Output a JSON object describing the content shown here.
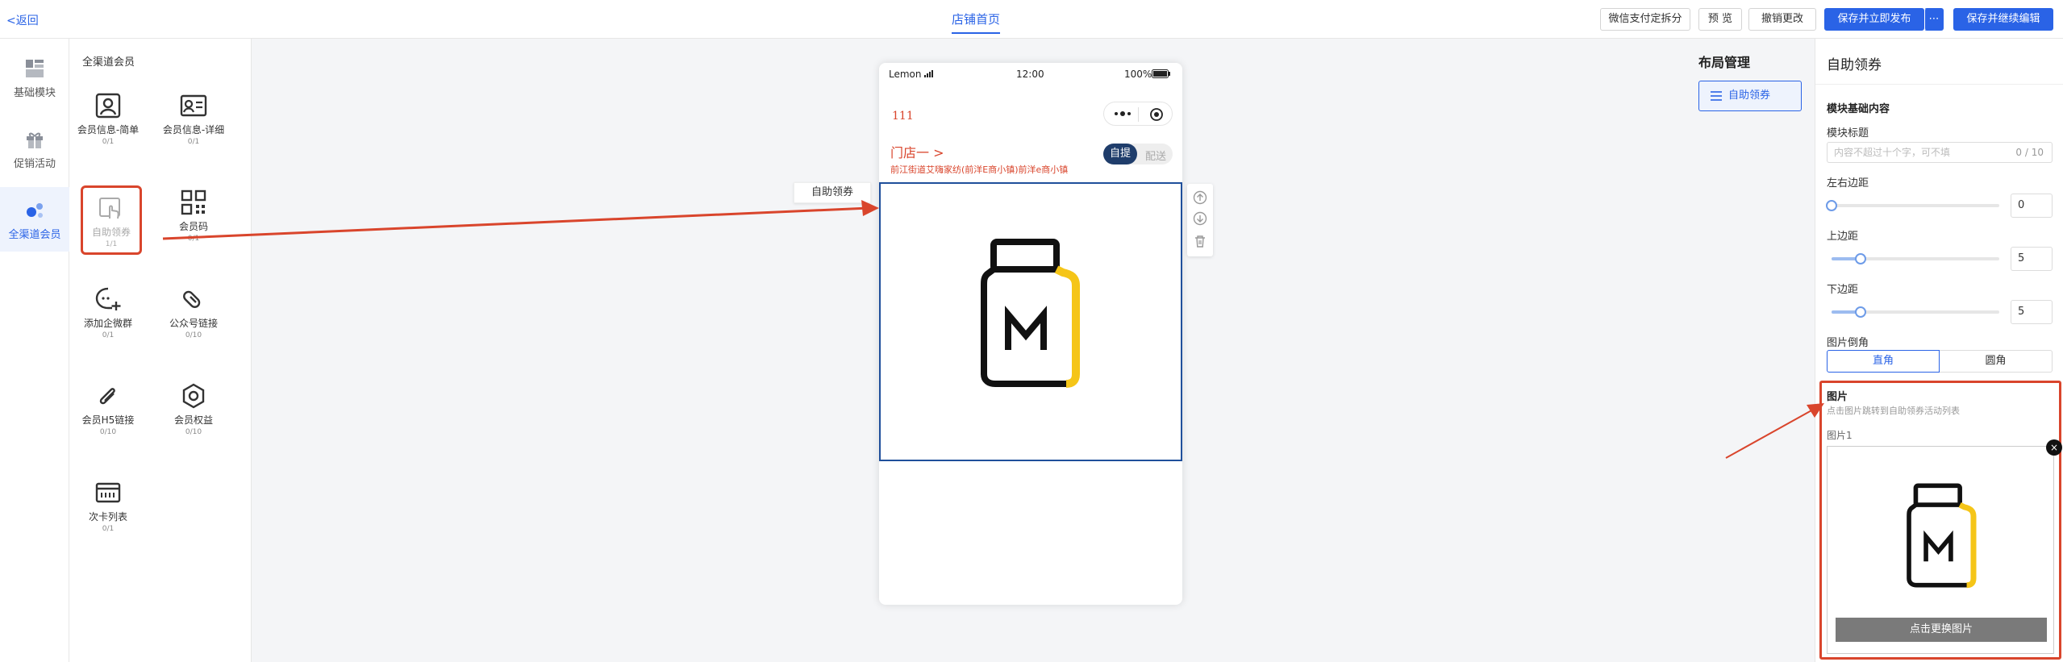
{
  "topbar": {
    "back": "<返回",
    "tab": "店铺首页",
    "buttons": [
      "微信支付定拆分",
      "预 览",
      "撤销更改",
      "保存并立即发布",
      "⋯",
      "保存并继续编辑"
    ]
  },
  "leftnav": {
    "items": [
      {
        "label": "基础模块",
        "icon": "layout-blocks-icon"
      },
      {
        "label": "促销活动",
        "icon": "gift-icon"
      },
      {
        "label": "全渠道会员",
        "icon": "member-dots-icon"
      }
    ],
    "active_index": 2
  },
  "components": {
    "title": "全渠道会员",
    "items": [
      {
        "label": "会员信息-简单",
        "count": "0/1",
        "icon": "user-card-icon"
      },
      {
        "label": "会员信息-详细",
        "count": "0/1",
        "icon": "user-detail-icon"
      },
      {
        "label": "自助领券",
        "count": "1/1",
        "icon": "coupon-hand-icon"
      },
      {
        "label": "会员码",
        "count": "0/1",
        "icon": "qrcode-icon"
      },
      {
        "label": "添加企微群",
        "count": "0/1",
        "icon": "chat-add-icon"
      },
      {
        "label": "公众号链接",
        "count": "0/10",
        "icon": "link-icon"
      },
      {
        "label": "会员H5链接",
        "count": "0/10",
        "icon": "paperclip-icon"
      },
      {
        "label": "会员权益",
        "count": "0/10",
        "icon": "badge-icon"
      },
      {
        "label": "次卡列表",
        "count": "0/1",
        "icon": "card-list-icon"
      }
    ]
  },
  "phone": {
    "carrier": "Lemon",
    "time": "12:00",
    "battery": "100%",
    "page_name": "111",
    "store_name": "门店一 >",
    "address": "前江街道艾嗨家纺(前洋E商小镇)前洋e商小镇",
    "delivery_on": "自提",
    "delivery_off": "配送",
    "module_tag": "自助领券"
  },
  "layout": {
    "title": "布局管理",
    "item": "自助领券"
  },
  "rpanel": {
    "title": "自助领券",
    "section": "模块基础内容",
    "module_title_label": "模块标题",
    "module_title_placeholder": "内容不超过十个字，可不填",
    "module_title_count": "0 / 10",
    "lr_margin_label": "左右边距",
    "lr_margin_value": "0",
    "top_margin_label": "上边距",
    "top_margin_value": "5",
    "bottom_margin_label": "下边距",
    "bottom_margin_value": "5",
    "corner_label": "图片倒角",
    "corner_options": [
      "直角",
      "圆角"
    ],
    "corner_selected": "直角",
    "image_section_title": "图片",
    "image_section_desc": "点击图片跳转到自助领券活动列表",
    "image1_label": "图片1",
    "image_change": "点击更换图片",
    "image_close": "×"
  },
  "colors": {
    "accent": "#2a63e6",
    "highlight": "#d9452c",
    "navy": "#1f3d6b",
    "brand_yellow": "#f5c518"
  }
}
